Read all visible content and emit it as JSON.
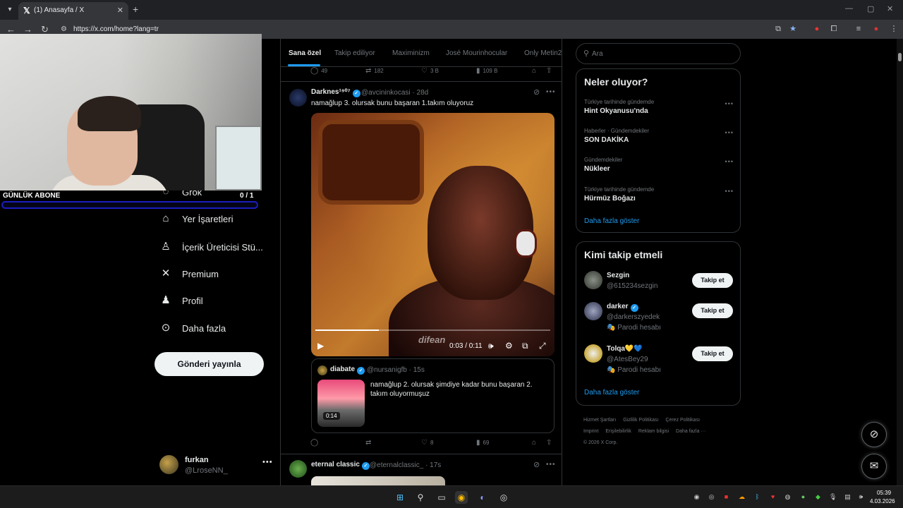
{
  "browser": {
    "tab_title": "(1) Anasayfa / X",
    "url": "https://x.com/home?lang=tr"
  },
  "stream_overlay": {
    "sub_label": "GÜNLÜK ABONE",
    "sub_count": "0 / 1",
    "progress": 0.0
  },
  "nav": {
    "items": [
      {
        "label": "Grok",
        "icon": "grok-icon"
      },
      {
        "label": "Yer İşaretleri",
        "icon": "bookmark-icon"
      },
      {
        "label": "İçerik Üreticisi Stü...",
        "icon": "creator-studio-icon"
      },
      {
        "label": "Premium",
        "icon": "x-logo-icon"
      },
      {
        "label": "Profil",
        "icon": "profile-icon"
      },
      {
        "label": "Daha fazla",
        "icon": "more-circle-icon"
      }
    ],
    "post_button": "Gönderi yayınla",
    "account": {
      "name": "furkan",
      "handle": "@LroseNN_"
    }
  },
  "timeline": {
    "tabs": [
      "Sana özel",
      "Takip ediliyor",
      "Maximinizm",
      "José Mourinhocular",
      "Only Metin2"
    ],
    "prev_actions": {
      "replies": "49",
      "reposts": "182",
      "likes": "3 B",
      "views": "109 B"
    },
    "tweet1": {
      "name": "Darknes¹⁹⁰⁷",
      "handle": "@avcininkocasi · 28d",
      "text": "namağlup 3. olursak bunu başaran 1.takım oluyoruz",
      "video": {
        "time": "0:03 / 0:11",
        "watermark": "difean",
        "progress": 0.27
      },
      "quote": {
        "name": "diabate",
        "handle": "@nursanigfb · 15s",
        "text": "namağlup 2. olursak şimdiye kadar bunu başaran 2. takım oluyormuşuz",
        "duration": "0:14"
      },
      "actions": {
        "replies": "",
        "reposts": "",
        "likes": "8",
        "views": "69"
      }
    },
    "tweet2": {
      "name": "eternal classic",
      "handle": "@eternalclassic_ · 17s"
    }
  },
  "sidebar": {
    "search_placeholder": "Ara",
    "trends_title": "Neler oluyor?",
    "trends": [
      {
        "context": "Türkiye tarihinde gündemde",
        "name": "Hint Okyanusu'nda"
      },
      {
        "context": "Haberler · Gündemdekiler",
        "name": "SON DAKİKA"
      },
      {
        "context": "Gündemdekiler",
        "name": "Nükleer"
      },
      {
        "context": "Türkiye tarihinde gündemde",
        "name": "Hürmüz Boğazı"
      }
    ],
    "trends_more": "Daha fazla göster",
    "who_title": "Kimi takip etmeli",
    "who": [
      {
        "name": "Sezgin",
        "handle": "@615234sezgin",
        "sub": "",
        "verified": false,
        "button": "Takip et"
      },
      {
        "name": "darker",
        "handle": "@darkerszyedek",
        "sub": "Parodi hesabı",
        "verified": true,
        "button": "Takip et"
      },
      {
        "name": "Tolqa💛💙",
        "handle": "@AtesBey29",
        "sub": "Parodi hesabı",
        "verified": false,
        "button": "Takip et"
      }
    ],
    "who_more": "Daha fazla göster",
    "footer": [
      "Hizmet Şartları",
      "Gizlilik Politikası",
      "Çerez Politikası",
      "Imprint",
      "Erişilebilirlik",
      "Reklam bilgisi",
      "Daha fazla ···",
      "© 2026 X Corp."
    ]
  },
  "taskbar": {
    "time": "05:39",
    "date": "4.03.2026"
  },
  "colors": {
    "accent": "#1d9bf0",
    "background": "#000000",
    "border": "#2f3336",
    "muted_text": "#71767b"
  }
}
